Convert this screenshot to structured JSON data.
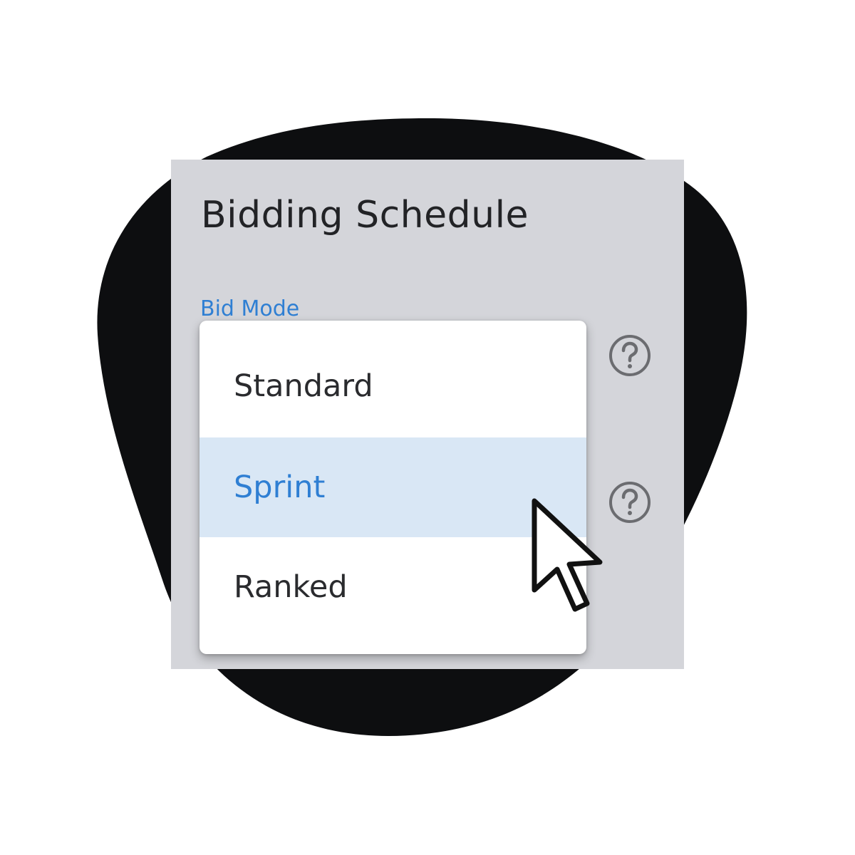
{
  "panel": {
    "title": "Bidding Schedule",
    "field_label": "Bid Mode"
  },
  "dropdown": {
    "options": [
      {
        "label": "Standard",
        "highlighted": false
      },
      {
        "label": "Sprint",
        "highlighted": true
      },
      {
        "label": "Ranked",
        "highlighted": false
      }
    ]
  },
  "icons": {
    "help_1": "help-circle-icon",
    "help_2": "help-circle-icon",
    "cursor": "mouse-pointer-icon"
  },
  "colors": {
    "background_blob": "#0d0e10",
    "panel": "#d4d5da",
    "accent": "#2f7fd3",
    "highlight": "#d9e7f5",
    "text": "#2a2b2e",
    "icon": "#6b6c70"
  }
}
